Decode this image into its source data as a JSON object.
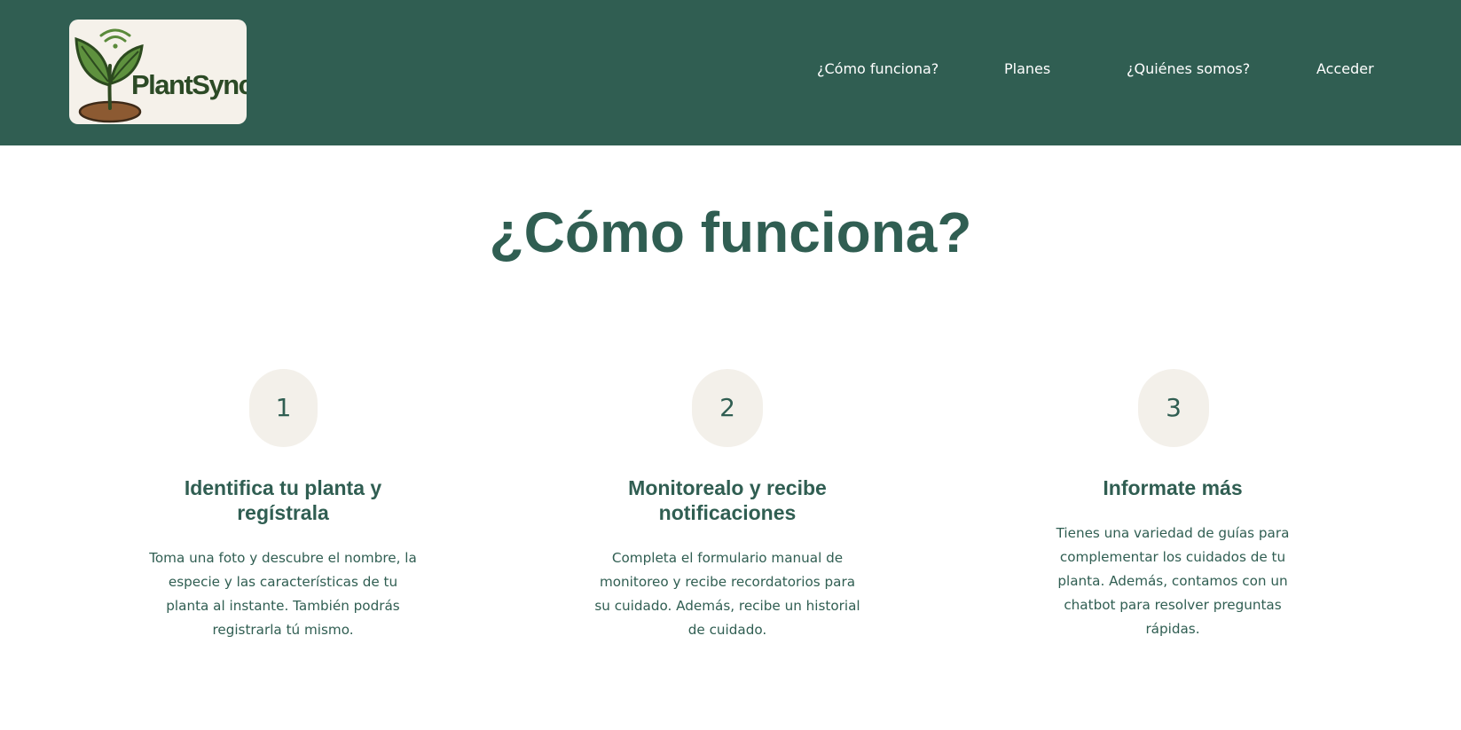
{
  "brand": {
    "name": "PlantSync",
    "logo_icon": "sprout-wifi-icon"
  },
  "nav": {
    "items": [
      {
        "label": "¿Cómo funciona?"
      },
      {
        "label": "Planes"
      },
      {
        "label": "¿Quiénes somos?"
      },
      {
        "label": "Acceder"
      }
    ]
  },
  "main": {
    "title": "¿Cómo funciona?",
    "steps": [
      {
        "number": "1",
        "title": "Identifica tu planta y regístrala",
        "description": "Toma una foto y descubre el nombre, la especie y las características de tu planta al instante. También podrás registrarla tú mismo."
      },
      {
        "number": "2",
        "title": "Monitorealo y recibe notificaciones",
        "description": "Completa el formulario manual de monitoreo y recibe recordatorios para su cuidado. Además, recibe un historial de cuidado."
      },
      {
        "number": "3",
        "title": "Informate más",
        "description": "Tienes una variedad de guías para complementar los cuidados de tu planta. Además, contamos con un chatbot para resolver preguntas rápidas."
      }
    ]
  },
  "colors": {
    "primary": "#305e52",
    "badge_bg": "#f3f0ea",
    "logo_bg": "#f5f1ea"
  }
}
